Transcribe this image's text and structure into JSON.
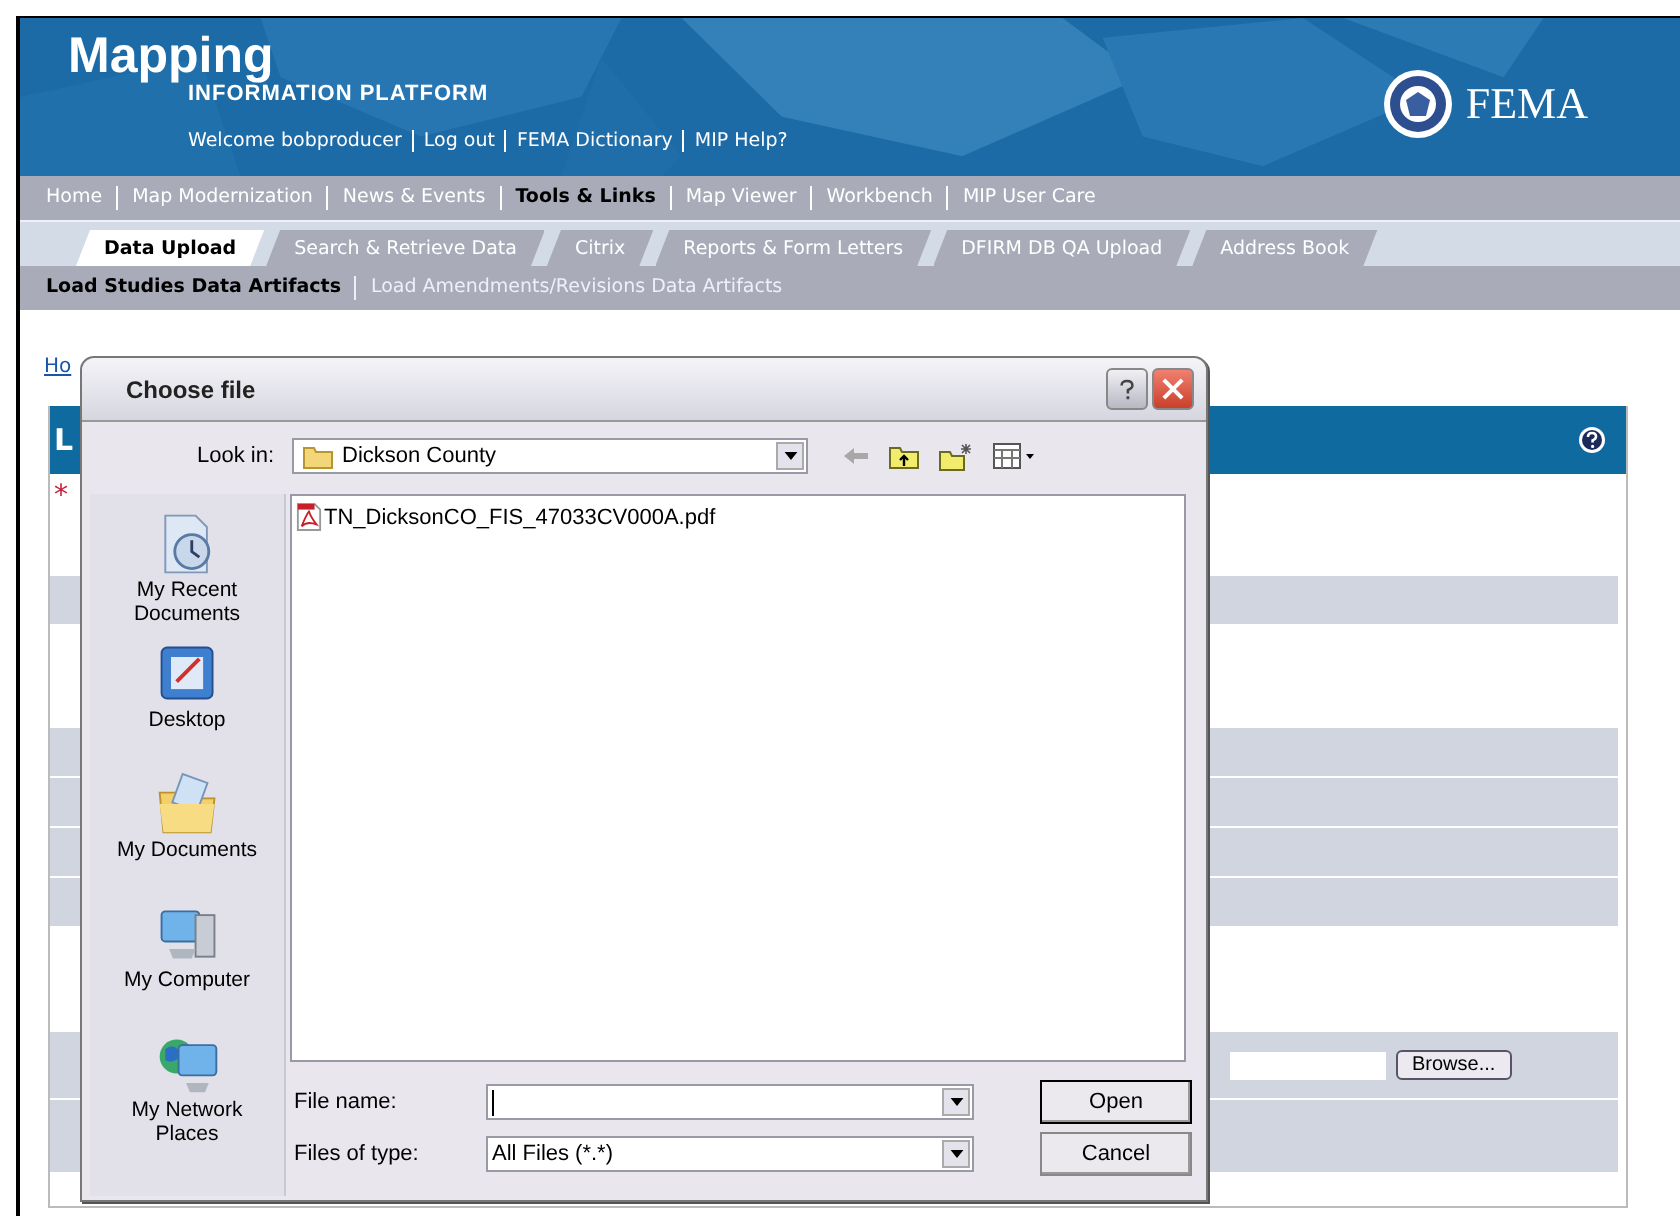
{
  "header": {
    "title": "Mapping",
    "subtitle": "INFORMATION PLATFORM",
    "links": [
      "Welcome bobproducer",
      "Log out",
      "FEMA Dictionary",
      "MIP Help?"
    ],
    "logo": "FEMA"
  },
  "nav": [
    {
      "label": "Home",
      "selected": false
    },
    {
      "label": "Map Modernization",
      "selected": false
    },
    {
      "label": "News & Events",
      "selected": false
    },
    {
      "label": "Tools & Links",
      "selected": true
    },
    {
      "label": "Map Viewer",
      "selected": false
    },
    {
      "label": "Workbench",
      "selected": false
    },
    {
      "label": "MIP User Care",
      "selected": false
    }
  ],
  "tabs": [
    {
      "label": "Data Upload",
      "selected": true
    },
    {
      "label": "Search & Retrieve Data",
      "selected": false
    },
    {
      "label": "Citrix",
      "selected": false
    },
    {
      "label": "Reports & Form Letters",
      "selected": false
    },
    {
      "label": "DFIRM DB QA Upload",
      "selected": false
    },
    {
      "label": "Address Book",
      "selected": false
    }
  ],
  "subnav": [
    {
      "label": "Load Studies Data Artifacts",
      "selected": true
    },
    {
      "label": "Load Amendments/Revisions Data Artifacts",
      "selected": false
    }
  ],
  "breadcrumb": "Ho",
  "panel": {
    "title": "L",
    "required_mark": "*",
    "browse_button": "Browse..."
  },
  "dialog": {
    "title": "Choose file",
    "look_in": {
      "label": "Look in:",
      "value": "Dickson County"
    },
    "places": [
      {
        "kind": "recent",
        "label": "My Recent Documents"
      },
      {
        "kind": "desktop",
        "label": "Desktop"
      },
      {
        "kind": "documents",
        "label": "My Documents"
      },
      {
        "kind": "computer",
        "label": "My Computer"
      },
      {
        "kind": "network",
        "label": "My Network Places"
      }
    ],
    "files": [
      {
        "name": "TN_DicksonCO_FIS_47033CV000A.pdf"
      }
    ],
    "file_name": {
      "label": "File name:"
    },
    "file_type": {
      "label": "Files of type:",
      "value": "All Files (*.*)"
    },
    "buttons": [
      "Open",
      "Cancel"
    ]
  }
}
